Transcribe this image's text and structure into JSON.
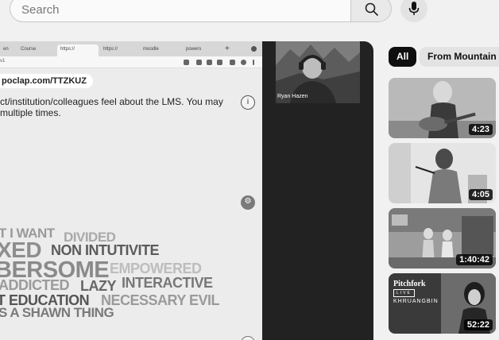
{
  "search": {
    "placeholder": "Search"
  },
  "player": {
    "browser_tabs": [
      "en",
      "Course",
      "https://",
      "https://",
      "moodle",
      "powers"
    ],
    "url_fragment": "v1",
    "poll_link": "poclap.com/TTZKUZ",
    "question": "ct/institution/colleagues feel about the LMS. You may multiple times.",
    "participant_name": "Ryan Hazen",
    "word_cloud": [
      {
        "text": "T I WANT",
        "color": "#9a9a9a",
        "tone": "light"
      },
      {
        "text": "DIVIDED",
        "color": "#a9a9a9",
        "tone": "light"
      },
      {
        "text": "XED",
        "color": "#8e8e8e",
        "tone": "mid"
      },
      {
        "text": "NON INTUTIVITE",
        "color": "#5b5b5b",
        "tone": "dark"
      },
      {
        "text": "BERSOME",
        "color": "#8a8a8a",
        "tone": "mid"
      },
      {
        "text": "EMPOWERED",
        "color": "#bdbdbd",
        "tone": "light"
      },
      {
        "text": "ADDICTED",
        "color": "#9b9b9b",
        "tone": "light"
      },
      {
        "text": "LAZY",
        "color": "#666666",
        "tone": "dark"
      },
      {
        "text": "INTERACTIVE",
        "color": "#777777",
        "tone": "dark"
      },
      {
        "text": "T EDUCATION",
        "color": "#555555",
        "tone": "dark"
      },
      {
        "text": "NECESSARY EVIL",
        "color": "#9a9a9a",
        "tone": "light"
      },
      {
        "text": "S A SHAWN THING",
        "color": "#7a7a7a",
        "tone": "mid"
      }
    ]
  },
  "chips": [
    {
      "label": "All",
      "selected": true
    },
    {
      "label": "From Mountain Mo",
      "selected": false
    }
  ],
  "videos": [
    {
      "duration": "4:23",
      "scene": "guitar-player"
    },
    {
      "duration": "4:05",
      "scene": "studio-singer"
    },
    {
      "duration": "1:40:42",
      "scene": "band-in-room"
    },
    {
      "duration": "52:22",
      "scene": "pitchfork-live",
      "brand": "Pitchfork",
      "badge": "LIVE",
      "artist": "KHRUANGBIN"
    }
  ]
}
